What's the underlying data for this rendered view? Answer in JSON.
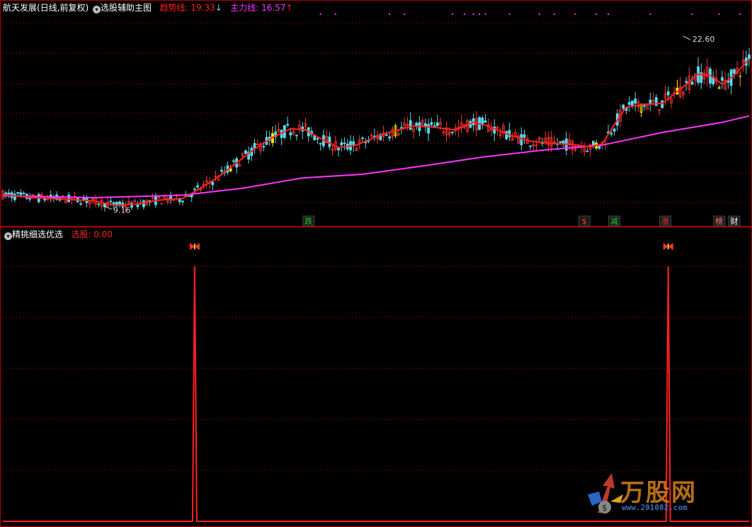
{
  "main_header": {
    "stock": "航天发展",
    "period": "(日线,前复权)",
    "indicator": "选股辅助主图",
    "trend_label": "趋势线: ",
    "trend_value": "19.33",
    "trend_arrow": "↓",
    "main_label": "主力线: ",
    "main_value": "16.57",
    "main_arrow": "↑"
  },
  "sub_header": {
    "indicator": "精挑细选优选",
    "select_label": "选股: ",
    "select_value": "0.00"
  },
  "watermark": {
    "brand": "万股网",
    "site": "www.201082.com"
  },
  "colors": {
    "trend": "#ff2020",
    "main": "#ff33ff",
    "up": "#ff3333",
    "down": "#55ddee",
    "grid": "#7a0000",
    "yellow": "#ffee00",
    "orange": "#ff9900"
  },
  "chart_data": [
    {
      "type": "candlestick",
      "series": [
        {
          "name": "趋势线",
          "role": "trend"
        },
        {
          "name": "主力线",
          "role": "main"
        }
      ],
      "x": {
        "start": 0,
        "end": 249
      },
      "ylim": [
        8.4,
        24.0
      ],
      "trend_points": [
        [
          0,
          10.1
        ],
        [
          10,
          9.85
        ],
        [
          20,
          9.75
        ],
        [
          30,
          9.6
        ],
        [
          38,
          9.25
        ],
        [
          45,
          9.35
        ],
        [
          52,
          9.65
        ],
        [
          60,
          9.8
        ],
        [
          66,
          10.6
        ],
        [
          72,
          11.5
        ],
        [
          78,
          12.6
        ],
        [
          84,
          13.7
        ],
        [
          90,
          14.6
        ],
        [
          96,
          15.3
        ],
        [
          101,
          15.2
        ],
        [
          107,
          14.4
        ],
        [
          112,
          13.8
        ],
        [
          118,
          14.0
        ],
        [
          124,
          14.6
        ],
        [
          130,
          15.1
        ],
        [
          137,
          15.5
        ],
        [
          144,
          15.4
        ],
        [
          151,
          15.2
        ],
        [
          157,
          15.8
        ],
        [
          162,
          15.5
        ],
        [
          168,
          14.9
        ],
        [
          175,
          14.35
        ],
        [
          182,
          14.15
        ],
        [
          190,
          14.05
        ],
        [
          196,
          13.85
        ],
        [
          200,
          14.1
        ],
        [
          204,
          15.6
        ],
        [
          208,
          17.0
        ],
        [
          214,
          17.2
        ],
        [
          220,
          17.3
        ],
        [
          226,
          18.4
        ],
        [
          232,
          19.6
        ],
        [
          236,
          19.5
        ],
        [
          240,
          18.8
        ],
        [
          244,
          19.5
        ],
        [
          249,
          20.8
        ]
      ],
      "main_points": [
        [
          0,
          10.0
        ],
        [
          30,
          9.85
        ],
        [
          60,
          10.05
        ],
        [
          80,
          10.6
        ],
        [
          100,
          11.4
        ],
        [
          120,
          11.7
        ],
        [
          140,
          12.35
        ],
        [
          160,
          13.05
        ],
        [
          180,
          13.6
        ],
        [
          200,
          14.0
        ],
        [
          220,
          15.0
        ],
        [
          240,
          15.8
        ],
        [
          249,
          16.3
        ]
      ],
      "high_label": "22.60",
      "high_point": [
        227,
        22.6
      ],
      "low_label": "9.16",
      "low_point": [
        34,
        9.16
      ],
      "markers": [
        {
          "label": "跌",
          "x": 102,
          "color": "#22cc22"
        },
        {
          "label": "$",
          "x": 194,
          "color": "#ff3333"
        },
        {
          "label": "减",
          "x": 204,
          "color": "#22cc22"
        },
        {
          "label": "涨",
          "x": 221,
          "color": "#ff3333"
        },
        {
          "label": "榜",
          "x": 239,
          "color": "#ff7777"
        },
        {
          "label": "财",
          "x": 244,
          "color": "#ffffff"
        }
      ],
      "top_dots": [
        106,
        111,
        129,
        134,
        150,
        154,
        157,
        159,
        161,
        169,
        179,
        184,
        191,
        198,
        202,
        216,
        230,
        239,
        246
      ]
    },
    {
      "type": "line",
      "series": [
        {
          "name": "选股"
        }
      ],
      "ylim": [
        0,
        1
      ],
      "x": {
        "start": 0,
        "end": 249
      },
      "spikes": [
        64,
        222
      ],
      "base": 0,
      "peak": 1
    }
  ]
}
